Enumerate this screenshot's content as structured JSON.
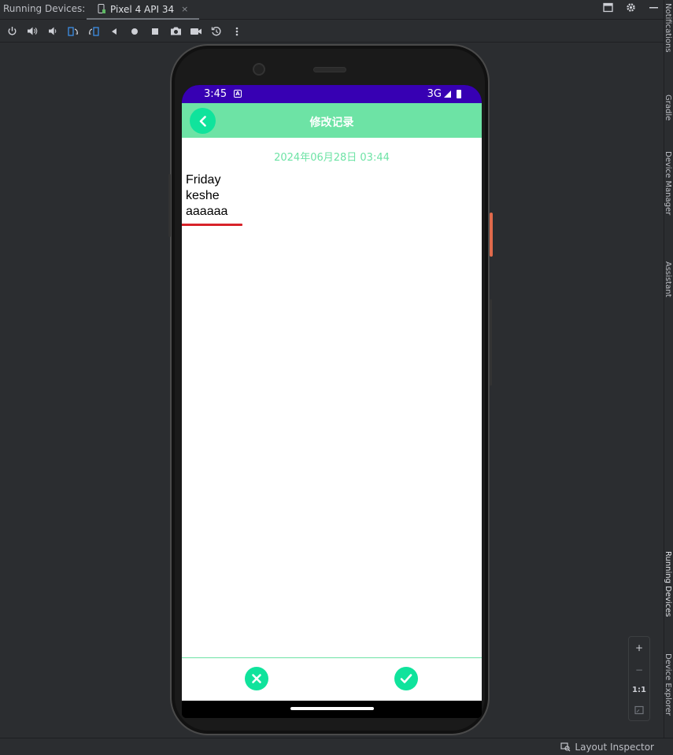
{
  "ide": {
    "panel_title": "Running Devices:",
    "device_tab": "Pixel 4 API 34",
    "device_tab_close": "×",
    "right_labels": [
      "Notifications",
      "Gradle",
      "Device Manager",
      "Assistant",
      "Running Devices",
      "Device Explorer"
    ],
    "zoom": {
      "plus": "+",
      "minus": "−",
      "one_to_one": "1:1"
    },
    "status": {
      "layout_inspector": "Layout Inspector"
    }
  },
  "toolbar_icons": [
    "power-icon",
    "volume-up-icon",
    "volume-down-icon",
    "rotate-left-icon",
    "rotate-right-icon",
    "back-icon",
    "home-icon",
    "overview-icon",
    "screenshot-icon",
    "screen-record-icon",
    "reset-icon",
    "more-icon"
  ],
  "device": {
    "status_bar": {
      "time": "3:45",
      "network": "3G"
    },
    "app_bar": {
      "title": "修改记录"
    },
    "note": {
      "date": "2024年06月28日 03:44",
      "body": "Friday\nkeshe\naaaaaa"
    }
  },
  "colors": {
    "status_bar": "#3700b3",
    "app_bar": "#6de3a5",
    "accent_button": "#10e39c",
    "date_text": "#6de3a5",
    "spell_underline": "#d8232a"
  }
}
